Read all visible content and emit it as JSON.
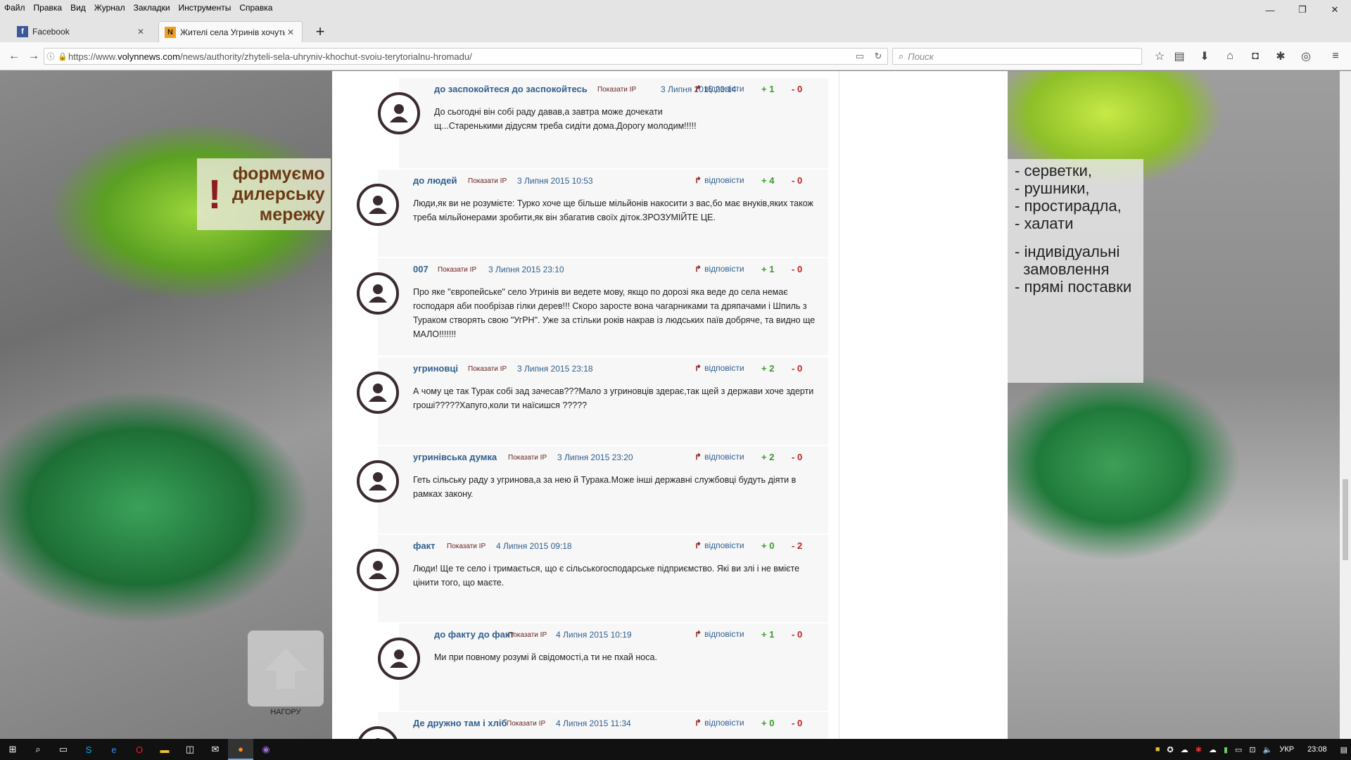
{
  "menubar": {
    "items": [
      "Файл",
      "Правка",
      "Вид",
      "Журнал",
      "Закладки",
      "Инструменты",
      "Справка"
    ]
  },
  "window_controls": {
    "minimize": "—",
    "restore": "❐",
    "close": "✕"
  },
  "tabs": [
    {
      "title": "Facebook",
      "favicon": "facebook-icon",
      "close": "✕"
    },
    {
      "title": "Жителі села Угринів хочуть",
      "favicon": "volynnews-icon",
      "close": "✕"
    }
  ],
  "newtab": "+",
  "nav": {
    "back": "←",
    "forward": "→",
    "url_prefix": "https://www.",
    "url_domain": "volynnews.com",
    "url_path": "/news/authority/zhyteli-sela-uhryniv-khochut-svoiu-terytorialnu-hromadu/",
    "search_placeholder": "Поиск"
  },
  "ads": {
    "left": {
      "excl": "!",
      "lines": [
        "формуємо",
        "дилерську",
        "мережу"
      ]
    },
    "right": {
      "lines1": [
        "- серветки,",
        "- рушники,",
        "- простирадла,",
        "- халати"
      ],
      "lines2": [
        "- індивідуальні",
        "  замовлення",
        "- прямі поставки"
      ]
    }
  },
  "totop_label": "НАГОРУ",
  "common": {
    "show_ip": "Показати IP",
    "reply": "відповісти"
  },
  "comments": [
    {
      "author": "до заспокойтеся до заспокойтесь",
      "date": "3 Липня 2015 23:14",
      "up": "+ 1",
      "down": "- 0",
      "text": "До сьогодні він собі раду давав,а завтра може дочекати щ...Старенькими дідусям треба сидіти дома.Дорогу молодим!!!!!"
    },
    {
      "author": "до людей",
      "date": "3 Липня 2015 10:53",
      "up": "+ 4",
      "down": "- 0",
      "text": "Люди,як ви не розумієте: Турко хоче ще більше мільйонів накосити з вас,бо має внуків,яких також треба мільйонерами зробити,як він збагатив своїх діток.ЗРОЗУМІЙТЕ ЦЕ."
    },
    {
      "author": "007",
      "date": "3 Липня 2015 23:10",
      "up": "+ 1",
      "down": "- 0",
      "text": "Про яке \"європейське\" село Угринів ви ведете мову, якщо по дорозі яка веде до села немає господаря аби пообрізав гілки дерев!!! Скоро заросте вона чагарниками та дряпачами і Шпиль з Тураком створять свою \"УгРН\". Уже за стільки років накрав із людських паїв добряче, та видно ще МАЛО!!!!!!!"
    },
    {
      "author": "угриновці",
      "date": "3 Липня 2015 23:18",
      "up": "+ 2",
      "down": "- 0",
      "text": "А чому це так Турак собі зад зачесав???Мало з угриновців здерає,так щей з держави хоче здерти гроші?????Хапуго,коли ти наїсишся ?????"
    },
    {
      "author": "угринівська думка",
      "date": "3 Липня 2015 23:20",
      "up": "+ 2",
      "down": "- 0",
      "text": "Геть сільську раду з угринова,а за нею й Турака.Може інші державні службовці будуть діяти в рамках закону."
    },
    {
      "author": "факт",
      "date": "4 Липня 2015 09:18",
      "up": "+ 0",
      "down": "- 2",
      "text": "Люди! Ще те село і тримається, що є сільськогосподарське підприємство. Які ви злі і не вмієте цінити того, що маєте."
    },
    {
      "author": "до факту до факт",
      "date": "4 Липня 2015 10:19",
      "up": "+ 1",
      "down": "- 0",
      "text": "Ми при повному розумі й свідомості,а ти не пхай носа."
    },
    {
      "author": "Де дружно там і хліб",
      "date": "4 Липня 2015 11:34",
      "up": "+ 0",
      "down": "- 0",
      "text": ""
    }
  ],
  "taskbar": {
    "items": [
      "start-icon",
      "search-icon",
      "task-view-icon",
      "skype-icon",
      "edge-icon",
      "opera-icon",
      "file-explorer-icon",
      "store-icon",
      "mail-icon",
      "firefox-icon",
      "viber-icon"
    ],
    "lang": "УКР",
    "time": "23:08"
  }
}
